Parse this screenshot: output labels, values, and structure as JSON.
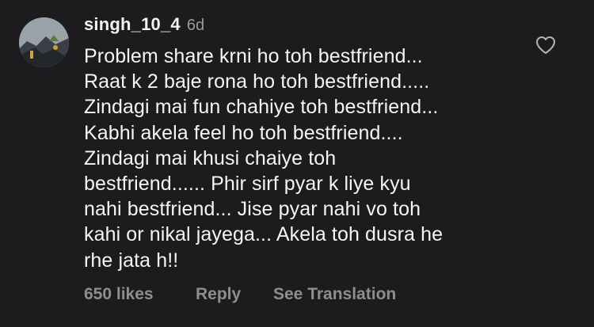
{
  "comment": {
    "username": "singh_10_4",
    "time": "6d",
    "text": "Problem share krni ho toh bestfriend...\nRaat k 2 baje rona ho toh bestfriend.....\nZindagi mai fun chahiye toh bestfriend...\nKabhi akela feel ho toh bestfriend....\nZindagi mai khusi chaiye toh\nbestfriend...... Phir sirf pyar k liye kyu\nnahi bestfriend... Jise pyar nahi vo toh\nkahi or nikal jayega... Akela toh dusra he\nrhe jata h!!",
    "likes_label": "650 likes",
    "reply_label": "Reply",
    "translate_label": "See Translation",
    "like_icon": "heart-outline-icon"
  },
  "colors": {
    "background": "#1c1c1e",
    "text": "#f5f5f5",
    "muted": "#8e8e8e"
  }
}
